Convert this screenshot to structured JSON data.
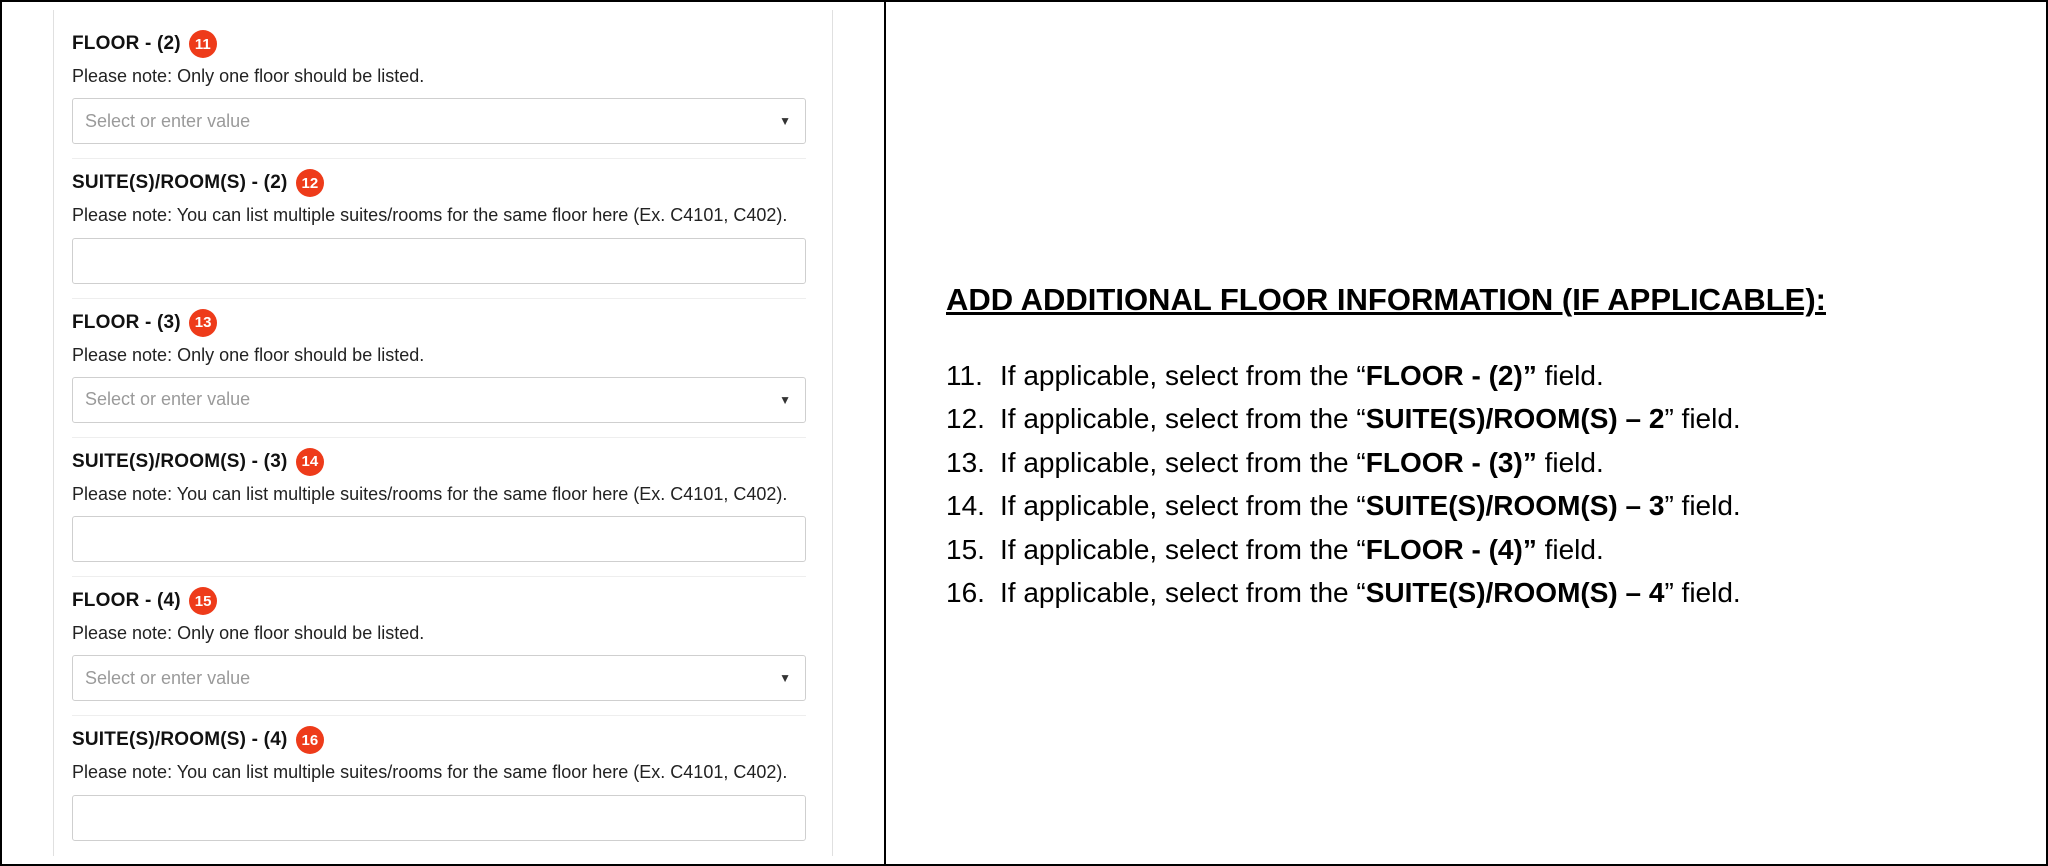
{
  "form": {
    "floor2": {
      "label": "FLOOR - (2)",
      "badge": "11",
      "note": "Please note: Only one floor should be listed.",
      "placeholder": "Select or enter value"
    },
    "suite2": {
      "label": "SUITE(S)/ROOM(S) - (2)",
      "badge": "12",
      "note": "Please note: You can list multiple suites/rooms for the same floor here (Ex. C4101, C402)."
    },
    "floor3": {
      "label": "FLOOR - (3)",
      "badge": "13",
      "note": "Please note: Only one floor should be listed.",
      "placeholder": "Select or enter value"
    },
    "suite3": {
      "label": "SUITE(S)/ROOM(S) - (3)",
      "badge": "14",
      "note": "Please note: You can list multiple suites/rooms for the same floor here (Ex. C4101, C402)."
    },
    "floor4": {
      "label": "FLOOR - (4)",
      "badge": "15",
      "note": "Please note: Only one floor should be listed.",
      "placeholder": "Select or enter value"
    },
    "suite4": {
      "label": "SUITE(S)/ROOM(S) - (4)",
      "badge": "16",
      "note": "Please note: You can list multiple suites/rooms for the same floor here (Ex. C4101, C402)."
    }
  },
  "instructions": {
    "heading": "ADD ADDITIONAL FLOOR INFORMATION (IF APPLICABLE):",
    "items": [
      {
        "num": "11.",
        "pre": "If applicable, select from the “",
        "bold": "FLOOR - (2)”",
        "post": " field."
      },
      {
        "num": "12.",
        "pre": "If applicable, select from the “",
        "bold": "SUITE(S)/ROOM(S) – 2",
        "post": "” field."
      },
      {
        "num": "13.",
        "pre": "If applicable, select from the “",
        "bold": "FLOOR - (3)”",
        "post": " field."
      },
      {
        "num": "14.",
        "pre": "If applicable, select from the “",
        "bold": "SUITE(S)/ROOM(S) – 3",
        "post": "” field."
      },
      {
        "num": "15.",
        "pre": "If applicable, select from the “",
        "bold": "FLOOR - (4)”",
        "post": " field."
      },
      {
        "num": "16.",
        "pre": "If applicable, select from the “",
        "bold": "SUITE(S)/ROOM(S) – 4",
        "post": "” field."
      }
    ]
  }
}
